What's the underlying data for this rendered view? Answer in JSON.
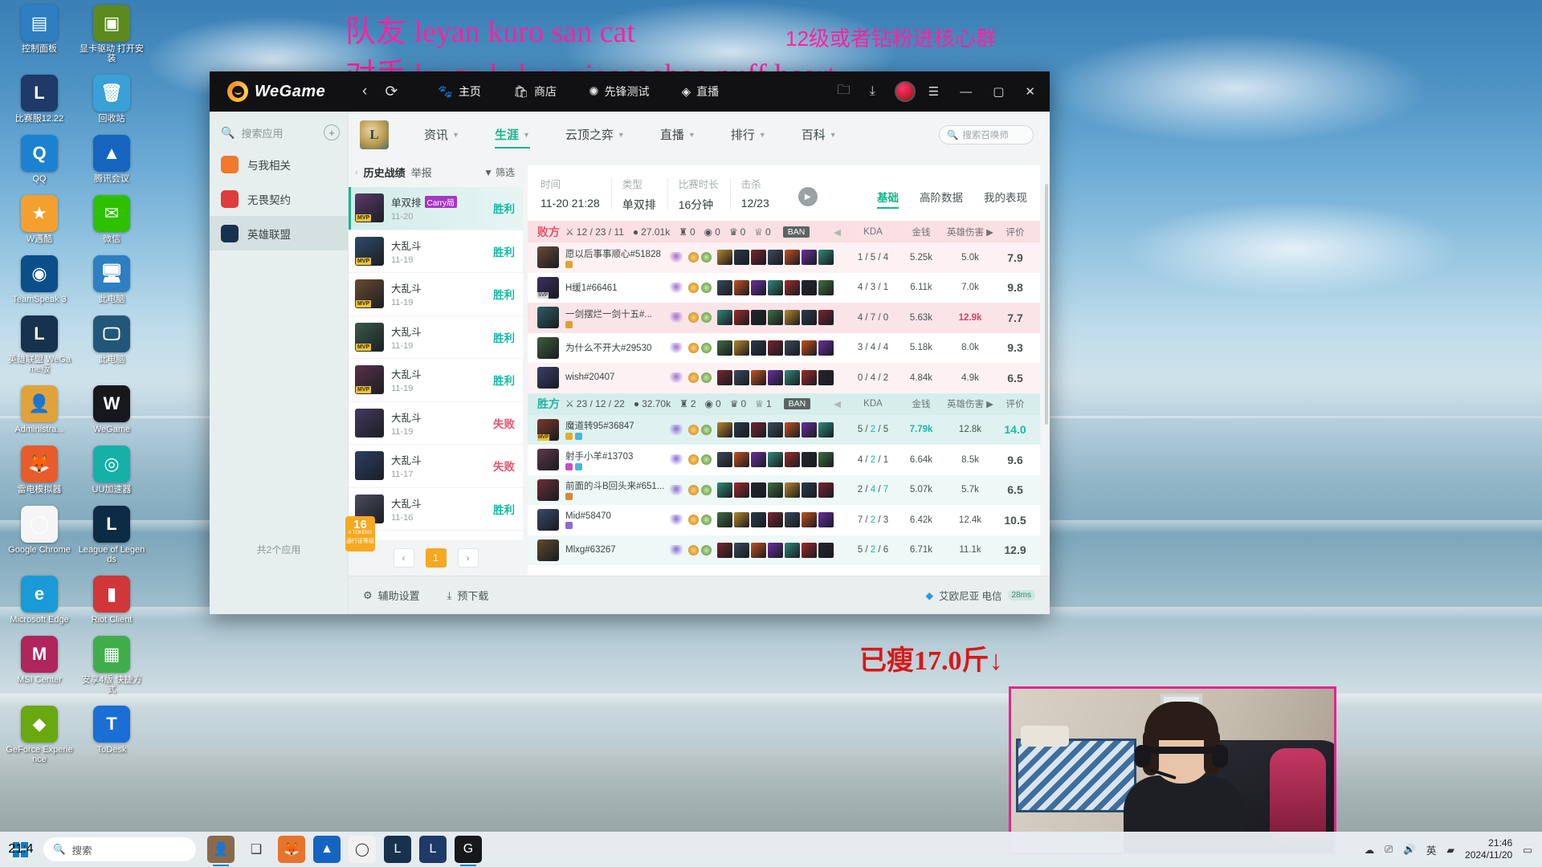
{
  "desktop": {
    "icons": [
      {
        "label": "控制面板",
        "color": "#2d7fc1",
        "glyph": "▤"
      },
      {
        "label": "显卡驱动 打开安装",
        "color": "#5c8a1e",
        "glyph": "▣"
      },
      {
        "label": "比赛服12.22",
        "color": "#1f3a68",
        "glyph": "L"
      },
      {
        "label": "回收站",
        "color": "#3aa0d8",
        "glyph": "🗑"
      },
      {
        "label": "QQ",
        "color": "#1b82d2",
        "glyph": "Q"
      },
      {
        "label": "腾讯会议",
        "color": "#1565c0",
        "glyph": "▲"
      },
      {
        "label": "W遇酷",
        "color": "#f59f2e",
        "glyph": "★"
      },
      {
        "label": "微信",
        "color": "#2dc100",
        "glyph": "✉"
      },
      {
        "label": "TeamSpeak 3",
        "color": "#0b4f8a",
        "glyph": "◉"
      },
      {
        "label": "此电脑",
        "color": "#2d7fc1",
        "glyph": "🖥"
      },
      {
        "label": "英雄联盟 WeGame版",
        "color": "#16324f",
        "glyph": "L"
      },
      {
        "label": "此电脑",
        "color": "#22577a",
        "glyph": "🖵"
      },
      {
        "label": "Administra...",
        "color": "#e2a23a",
        "glyph": "👤"
      },
      {
        "label": "WeGame",
        "color": "#17181c",
        "glyph": "W"
      },
      {
        "label": "雷电模拟器",
        "color": "#e85b2a",
        "glyph": "🦊"
      },
      {
        "label": "UU加速器",
        "color": "#16b0a6",
        "glyph": "◎"
      },
      {
        "label": "Google Chrome",
        "color": "#f5f5f5",
        "glyph": "◯"
      },
      {
        "label": "League of Legends",
        "color": "#0d2b45",
        "glyph": "L"
      },
      {
        "label": "Microsoft Edge",
        "color": "#1a9bd7",
        "glyph": "e"
      },
      {
        "label": "Riot Client",
        "color": "#d13639",
        "glyph": "▮"
      },
      {
        "label": "MSI Center",
        "color": "#b0255c",
        "glyph": "M"
      },
      {
        "label": "安享4版 快捷方式",
        "color": "#3fae4a",
        "glyph": "▦"
      },
      {
        "label": "GeForce Experience",
        "color": "#6aa80f",
        "glyph": "◆"
      },
      {
        "label": "ToDesk",
        "color": "#1a6fd4",
        "glyph": "T"
      }
    ]
  },
  "overlays": {
    "line1": "队友 leyan kuro san cat",
    "line2": "对手 langx kakao xiaocaobao puff heart",
    "line3": "12级或者钻粉进核心群",
    "line4": "已瘦17.0斤↓"
  },
  "wegame": {
    "app_name": "WeGame",
    "nav": {
      "back": "‹",
      "refresh": "⟳"
    },
    "tabs": [
      {
        "label": "主页",
        "icon": "home-icon",
        "active": true
      },
      {
        "label": "商店",
        "icon": "shop-icon",
        "active": false
      },
      {
        "label": "先锋测试",
        "icon": "beta-icon",
        "active": false
      },
      {
        "label": "直播",
        "icon": "live-icon",
        "active": false
      }
    ],
    "right_icons": [
      "folder-icon",
      "download-icon",
      "avatar-icon"
    ],
    "window_controls": [
      "menu-icon",
      "minimize-icon",
      "maximize-icon",
      "close-icon"
    ]
  },
  "app_sidebar": {
    "search_placeholder": "搜索应用",
    "add_label": "+",
    "items": [
      {
        "label": "与我相关",
        "icon": "related-icon",
        "color": "#f0792c",
        "selected": false
      },
      {
        "label": "无畏契约",
        "icon": "valorant-icon",
        "color": "#e03c3c",
        "selected": false
      },
      {
        "label": "英雄联盟",
        "icon": "lol-icon",
        "color": "#16324f",
        "selected": true
      }
    ],
    "footer": "共2个应用"
  },
  "lol_nav": {
    "crest": "L",
    "tabs": [
      {
        "label": "资讯",
        "caret": true,
        "active": false
      },
      {
        "label": "生涯",
        "caret": true,
        "active": true
      },
      {
        "label": "云顶之弈",
        "caret": true,
        "active": false
      },
      {
        "label": "直播",
        "caret": true,
        "active": false
      },
      {
        "label": "排行",
        "caret": true,
        "active": false
      },
      {
        "label": "百科",
        "caret": true,
        "active": false
      }
    ],
    "summoner_search_placeholder": "搜索召唤师"
  },
  "match_list": {
    "title": "历史战绩",
    "report": "举报",
    "filter": "筛选",
    "rows": [
      {
        "mode": "单双排",
        "badge": "Carry局",
        "date": "11-20",
        "result": "胜利",
        "win": true,
        "mvp": true,
        "selected": true,
        "champ": "#5a3a6b"
      },
      {
        "mode": "大乱斗",
        "badge": "",
        "date": "11-19",
        "result": "胜利",
        "win": true,
        "mvp": true,
        "selected": false,
        "champ": "#2f4a6b"
      },
      {
        "mode": "大乱斗",
        "badge": "",
        "date": "11-19",
        "result": "胜利",
        "win": true,
        "mvp": true,
        "selected": false,
        "champ": "#6b4a2f"
      },
      {
        "mode": "大乱斗",
        "badge": "",
        "date": "11-19",
        "result": "胜利",
        "win": true,
        "mvp": true,
        "selected": false,
        "champ": "#3a5a4a"
      },
      {
        "mode": "大乱斗",
        "badge": "",
        "date": "11-19",
        "result": "胜利",
        "win": true,
        "mvp": true,
        "selected": false,
        "champ": "#5a2f4a"
      },
      {
        "mode": "大乱斗",
        "badge": "",
        "date": "11-19",
        "result": "失败",
        "win": false,
        "mvp": false,
        "selected": false,
        "champ": "#46395e"
      },
      {
        "mode": "大乱斗",
        "badge": "",
        "date": "11-17",
        "result": "失败",
        "win": false,
        "mvp": false,
        "selected": false,
        "champ": "#2b3f63"
      },
      {
        "mode": "大乱斗",
        "badge": "",
        "date": "11-16",
        "result": "胜利",
        "win": true,
        "mvp": false,
        "selected": false,
        "champ": "#4a4a5e"
      }
    ],
    "pager": {
      "prev": "‹",
      "page": "1",
      "next": "›"
    }
  },
  "mini_badge": {
    "number": "16",
    "sub": "4 TOKENS",
    "text": "通行证等级"
  },
  "match_detail": {
    "meta": [
      {
        "label": "时间",
        "value": "11-20 21:28"
      },
      {
        "label": "类型",
        "value": "单双排"
      },
      {
        "label": "比赛时长",
        "value": "16分钟"
      },
      {
        "label": "击杀",
        "value": "12/23"
      }
    ],
    "tabs": [
      {
        "label": "基础",
        "active": true
      },
      {
        "label": "高阶数据",
        "active": false
      },
      {
        "label": "我的表现",
        "active": false
      }
    ],
    "columns": [
      "KDA",
      "金钱",
      "英雄伤害",
      "评价"
    ],
    "teams": [
      {
        "name": "败方",
        "win": false,
        "kda": "12 / 23 / 11",
        "gold": "27.01k",
        "stats": [
          {
            "icon": "tower-icon",
            "value": "0"
          },
          {
            "icon": "inhibitor-icon",
            "value": "0"
          },
          {
            "icon": "baron-icon",
            "value": "0"
          },
          {
            "icon": "dragon-icon",
            "value": "0"
          }
        ],
        "ban": "BAN",
        "players": [
          {
            "name": "愿以后事事顺心#51828",
            "kda": "1 / 5 / 4",
            "gold": "5.25k",
            "dmg": "5.0k",
            "score": "7.9",
            "tag": "",
            "champ": "#6b4a3a",
            "hl": false,
            "dmg_top": false,
            "gold_top": false,
            "badges": [
              "#e0a62c"
            ]
          },
          {
            "name": "H缓1#66461",
            "kda": "4 / 3 / 1",
            "gold": "6.11k",
            "dmg": "7.0k",
            "score": "9.8",
            "tag": "SVP",
            "champ": "#3c2f5e",
            "hl": false,
            "dmg_top": false,
            "gold_top": false,
            "badges": []
          },
          {
            "name": "一剑摆烂一剑十五#...",
            "kda": "4 / 7 / 0",
            "gold": "5.63k",
            "dmg": "12.9k",
            "score": "7.7",
            "tag": "",
            "champ": "#2f5e63",
            "hl": true,
            "dmg_top": true,
            "gold_top": false,
            "badges": [
              "#e2a033"
            ]
          },
          {
            "name": "为什么不开大#29530",
            "kda": "3 / 4 / 4",
            "gold": "5.18k",
            "dmg": "8.0k",
            "score": "9.3",
            "tag": "",
            "champ": "#3d5e3a",
            "hl": false,
            "dmg_top": false,
            "gold_top": false,
            "badges": []
          },
          {
            "name": "wish#20407",
            "kda": "0 / 4 / 2",
            "gold": "4.84k",
            "dmg": "4.9k",
            "score": "6.5",
            "tag": "",
            "champ": "#3a3f6b",
            "hl": false,
            "dmg_top": false,
            "gold_top": false,
            "badges": []
          }
        ]
      },
      {
        "name": "胜方",
        "win": true,
        "kda": "23 / 12 / 22",
        "gold": "32.70k",
        "stats": [
          {
            "icon": "tower-icon",
            "value": "2"
          },
          {
            "icon": "inhibitor-icon",
            "value": "0"
          },
          {
            "icon": "baron-icon",
            "value": "0"
          },
          {
            "icon": "dragon-icon",
            "value": "1"
          }
        ],
        "ban": "BAN",
        "players": [
          {
            "name": "魔道转95#36847",
            "kda": "5 / 2 / 5",
            "gold": "7.79k",
            "dmg": "12.8k",
            "score": "14.0",
            "tag": "MVP",
            "champ": "#7a3a2a",
            "hl": true,
            "dmg_top": false,
            "gold_top": true,
            "score_hl": true,
            "badges": [
              "#e0b02c",
              "#49b6d8"
            ]
          },
          {
            "name": "射手小羊#13703",
            "kda": "4 / 2 / 1",
            "gold": "6.64k",
            "dmg": "8.5k",
            "score": "9.6",
            "tag": "",
            "champ": "#5e3a4a",
            "hl": false,
            "dmg_top": false,
            "gold_top": false,
            "badges": [
              "#c44ec4",
              "#49b6d8"
            ]
          },
          {
            "name": "前面的斗B回头来#651...",
            "kda": "2 / 4 / 7",
            "gold": "5.07k",
            "dmg": "5.7k",
            "score": "6.5",
            "tag": "",
            "champ": "#6b2f3a",
            "hl": false,
            "dmg_top": false,
            "gold_top": false,
            "badges": [
              "#d98a2c"
            ]
          },
          {
            "name": "Mid#58470",
            "kda": "7 / 2 / 3",
            "gold": "6.42k",
            "dmg": "12.4k",
            "score": "10.5",
            "tag": "",
            "champ": "#3a4a6b",
            "hl": false,
            "dmg_top": false,
            "gold_top": false,
            "badges": [
              "#8a6bd0"
            ]
          },
          {
            "name": "Mlxg#63267",
            "kda": "5 / 2 / 6",
            "gold": "6.71k",
            "dmg": "11.1k",
            "score": "12.9",
            "tag": "",
            "champ": "#5e4a2f",
            "hl": false,
            "dmg_top": false,
            "gold_top": false,
            "badges": []
          }
        ]
      }
    ]
  },
  "bottombar": {
    "items": [
      {
        "label": "辅助设置",
        "icon": "settings-icon"
      },
      {
        "label": "预下载",
        "icon": "download-icon"
      }
    ],
    "server": "艾欧尼亚 电信",
    "ping": "28ms"
  },
  "taskbar": {
    "search_placeholder": "搜索",
    "apps": [
      {
        "name": "webcam-app",
        "color": "#8a6a4a",
        "glyph": "👤",
        "active": true
      },
      {
        "name": "task-view",
        "color": "transparent",
        "glyph": "❑",
        "active": false
      },
      {
        "name": "firefox-app",
        "color": "#e8742a",
        "glyph": "🦊",
        "active": false
      },
      {
        "name": "tencent-meeting-app",
        "color": "#1565c0",
        "glyph": "▲",
        "active": false
      },
      {
        "name": "chrome-app",
        "color": "#f1f1f1",
        "glyph": "◯",
        "active": false
      },
      {
        "name": "lol-app",
        "color": "#16324f",
        "glyph": "L",
        "active": false
      },
      {
        "name": "lol-wegame-app",
        "color": "#1f3a68",
        "glyph": "L",
        "active": false
      },
      {
        "name": "wegame-app",
        "color": "#17181c",
        "glyph": "G",
        "active": true
      }
    ],
    "tray_icons": [
      "cloud-icon",
      "usb-icon",
      "volume-icon",
      "ime-icon",
      "network-icon"
    ],
    "ime": "英",
    "time": "21:46",
    "date": "2024/11/20",
    "corner_time": "21:4"
  }
}
